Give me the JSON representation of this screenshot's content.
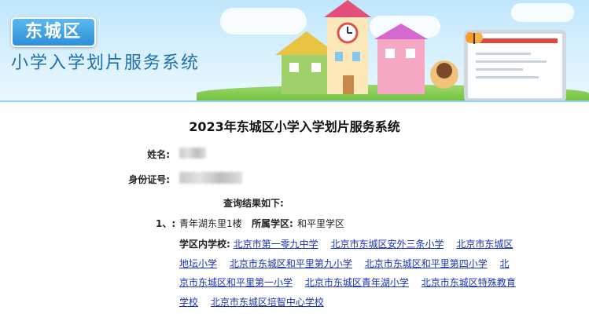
{
  "header": {
    "district_badge": "东城区",
    "system_name": "小学入学划片服务系统"
  },
  "page_title": "2023年东城区小学入学划片服务系统",
  "form": {
    "name_label": "姓名:",
    "id_label": "身份证号:"
  },
  "result": {
    "heading": "查询结果如下:",
    "index": "1、:",
    "address": "青年湖东里1楼",
    "district_label": "所属学区:",
    "district_value": "和平里学区",
    "schools_label": "学区内学校:",
    "schools": [
      "北京市第一零九中学",
      "北京市东城区安外三条小学",
      "北京市东城区地坛小学",
      "北京市东城区和平里第九小学",
      "北京市东城区和平里第四小学",
      "北京市东城区和平里第一小学",
      "北京市东城区青年湖小学",
      "北京市东城区特殊教育学校",
      "北京市东城区培智中心学校"
    ]
  },
  "colors": {
    "link": "#1a35b8",
    "banner_blue": "#2f8fd8"
  }
}
